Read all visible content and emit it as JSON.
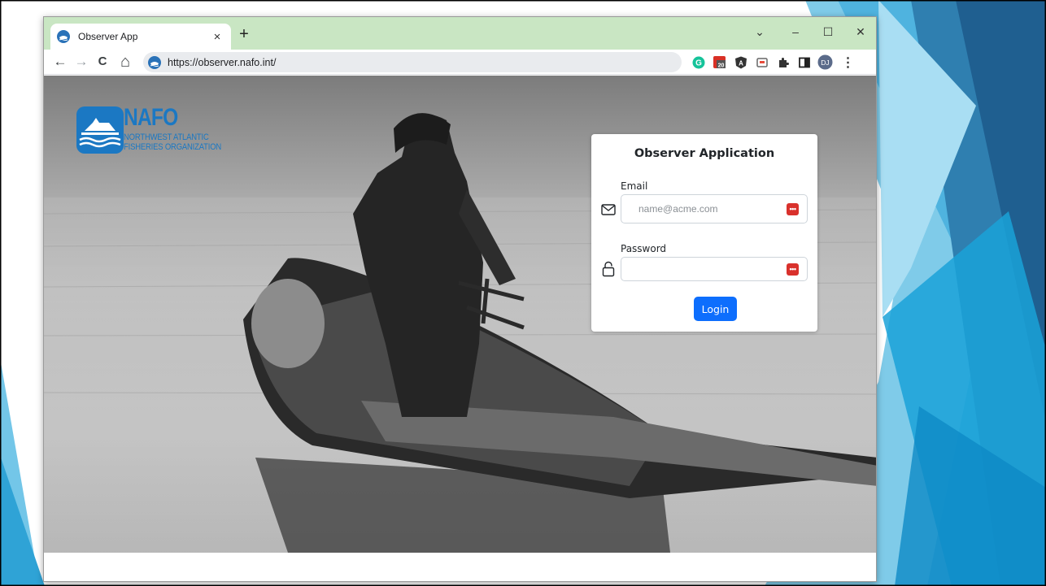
{
  "browser": {
    "tab_title": "Observer App",
    "tab_close": "×",
    "new_tab": "+",
    "window_controls": {
      "dropdown": "⌄",
      "minimize": "–",
      "maximize": "☐",
      "close": "✕"
    },
    "nav": {
      "back": "←",
      "forward": "→",
      "reload": "C",
      "home": "⌂"
    },
    "url": "https://observer.nafo.int/",
    "extensions": [
      "grammarly-icon",
      "calendar-icon",
      "angular-icon",
      "extension-icon",
      "puzzle-icon",
      "sidepanel-icon",
      "profile-avatar",
      "menu-icon"
    ],
    "calendar_badge": "20",
    "profile_initials": "DJ",
    "menu_label": "⋮"
  },
  "logo": {
    "word": "NAFO",
    "line1": "NORTHWEST ATLANTIC",
    "line2": "FISHERIES ORGANIZATION",
    "color": "#1b78c3"
  },
  "login": {
    "title": "Observer Application",
    "email_label": "Email",
    "email_placeholder": "name@acme.com",
    "email_value": "",
    "password_label": "Password",
    "password_value": "",
    "password_manager_glyph": "•••",
    "button_label": "Login",
    "button_color": "#0d6efd"
  }
}
